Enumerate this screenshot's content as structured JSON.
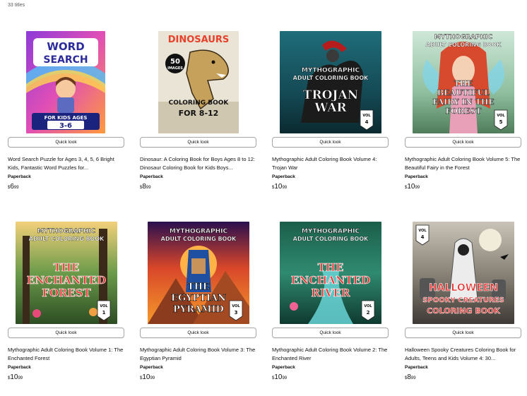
{
  "results": {
    "count_label": "33 titles"
  },
  "products": [
    {
      "title": "Word Search Puzzle for Ages 3, 4, 5, 6 Bright Kids, Fantastic Word Puzzles for...",
      "format": "Paperback",
      "price_symbol": "$",
      "price_whole": "6",
      "price_cents": "99",
      "quick_look": "Quick look",
      "cover": {
        "style": "wordsearch",
        "text1": "WORD",
        "text2": "SEARCH",
        "text3": "FOR KIDS AGES",
        "text4": "3-6"
      }
    },
    {
      "title": "Dinosaur: A Coloring Book for Boys Ages 8 to 12: Dinosaur Coloring Book for Kids Boys...",
      "format": "Paperback",
      "price_symbol": "$",
      "price_whole": "8",
      "price_cents": "99",
      "quick_look": "Quick look",
      "cover": {
        "style": "dinosaur",
        "text1": "DINOSAURS",
        "text2": "50",
        "text3": "IMAGES",
        "text4": "COLORING BOOK",
        "text5": "FOR 8-12"
      }
    },
    {
      "title": "Mythographic Adult Coloring Book Volume 4: Trojan War",
      "format": "Paperback",
      "price_symbol": "$",
      "price_whole": "10",
      "price_cents": "99",
      "quick_look": "Quick look",
      "cover": {
        "style": "trojan",
        "text1": "MYTHOGRAPHIC",
        "text2": "ADULT COLORING BOOK",
        "text3": "TROJAN",
        "text4": "WAR",
        "vol": "VOL",
        "vol_num": "4"
      }
    },
    {
      "title": "Mythographic Adult Coloring Book Volume 5: The Beautiful Fairy in the Forest",
      "format": "Paperback",
      "price_symbol": "$",
      "price_whole": "10",
      "price_cents": "99",
      "quick_look": "Quick look",
      "cover": {
        "style": "fairy",
        "text1": "MYTHOGRAPHIC",
        "text2": "ADULT COLORING BOOK",
        "text3": "THE",
        "text4": "BEAUTIFUL",
        "text5": "FAIRY IN THE",
        "text6": "FOREST",
        "vol": "VOL",
        "vol_num": "5"
      }
    },
    {
      "title": "Mythographic Adult Coloring Book Volume 1: The Enchanted Forest",
      "format": "Paperback",
      "price_symbol": "$",
      "price_whole": "10",
      "price_cents": "99",
      "quick_look": "Quick look",
      "cover": {
        "style": "forest",
        "text1": "MYTHOGRAPHIC",
        "text2": "ADULT COLORING BOOK",
        "text3": "THE",
        "text4": "ENCHANTED",
        "text5": "FOREST",
        "vol": "VOL",
        "vol_num": "1"
      }
    },
    {
      "title": "Mythographic Adult Coloring Book Volume 3: The Egyptian Pyramid",
      "format": "Paperback",
      "price_symbol": "$",
      "price_whole": "10",
      "price_cents": "99",
      "quick_look": "Quick look",
      "cover": {
        "style": "egypt",
        "text1": "MYTHOGRAPHIC",
        "text2": "ADULT COLORING BOOK",
        "text3": "THE",
        "text4": "EGYPTIAN",
        "text5": "PYRAMID",
        "vol": "VOL",
        "vol_num": "3"
      }
    },
    {
      "title": "Mythographic Adult Coloring Book Volume 2: The Enchanted River",
      "format": "Paperback",
      "price_symbol": "$",
      "price_whole": "10",
      "price_cents": "99",
      "quick_look": "Quick look",
      "cover": {
        "style": "river",
        "text1": "MYTHOGRAPHIC",
        "text2": "ADULT COLORING BOOK",
        "text3": "THE",
        "text4": "ENCHANTED",
        "text5": "RIVER",
        "vol": "VOL",
        "vol_num": "2"
      }
    },
    {
      "title": "Halloween Spooky Creatures Coloring Book for Adults, Teens and Kids Volume 4: 30...",
      "format": "Paperback",
      "price_symbol": "$",
      "price_whole": "8",
      "price_cents": "99",
      "quick_look": "Quick look",
      "cover": {
        "style": "halloween",
        "text1": "HALLOWEEN",
        "text2": "SPOOKY CREATURES",
        "text3": "COLORING BOOK",
        "vol": "VOL",
        "vol_num": "4"
      }
    }
  ]
}
